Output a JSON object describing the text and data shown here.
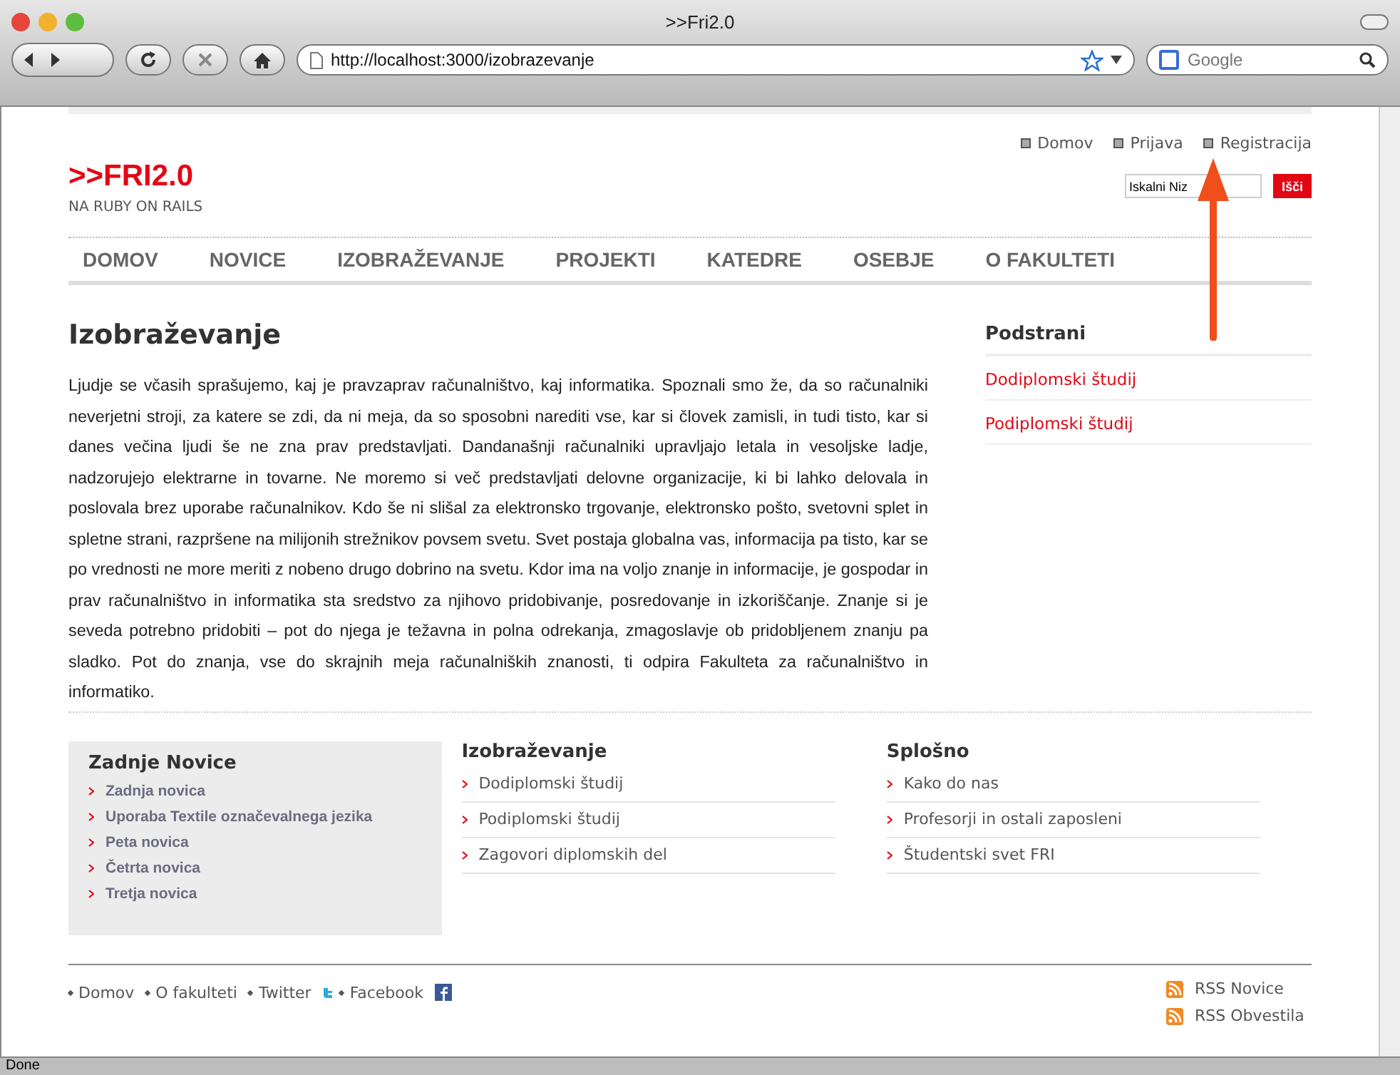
{
  "window": {
    "title": ">>Fri2.0"
  },
  "toolbar": {
    "url": "http://localhost:3000/izobrazevanje",
    "search_placeholder": "Google"
  },
  "site": {
    "logo": ">>FRI2.0",
    "tagline": "NA RUBY ON RAILS"
  },
  "top_links": [
    "Domov",
    "Prijava",
    "Registracija"
  ],
  "search": {
    "value": "Iskalni Niz",
    "button": "Išči"
  },
  "nav": [
    {
      "label": "DOMOV"
    },
    {
      "label": "NOVICE"
    },
    {
      "label": "IZOBRAŽEVANJE"
    },
    {
      "label": "PROJEKTI"
    },
    {
      "label": "KATEDRE"
    },
    {
      "label": "OSEBJE"
    },
    {
      "label": "O FAKULTETI"
    }
  ],
  "article": {
    "title": "Izobraževanje",
    "body": "Ljudje se včasih sprašujemo, kaj je pravzaprav računalništvo, kaj informatika. Spoznali smo že, da so računalniki neverjetni stroji, za katere se zdi, da ni meja, da so sposobni narediti vse, kar si človek zamisli, in tudi tisto, kar si danes večina ljudi še ne zna prav predstavljati. Dandanašnji računalniki upravljajo letala in vesoljske ladje, nadzorujejo elektrarne in tovarne. Ne moremo si več predstavljati delovne organizacije, ki bi lahko delovala in poslovala brez uporabe računalnikov. Kdo še ni slišal za elektronsko trgovanje, elektronsko pošto, svetovni splet in spletne strani, razpršene na milijonih strežnikov povsem svetu. Svet postaja globalna vas, informacija pa tisto, kar se po vrednosti ne more meriti z nobeno drugo dobrino na svetu. Kdor ima na voljo znanje in informacije, je gospodar in prav računalništvo in informatika sta sredstvo za njihovo pridobivanje, posredovanje in izkoriščanje. Znanje si je seveda potrebno pridobiti – pot do njega je težavna in polna odrekanja, zmagoslavje ob pridobljenem znanju pa sladko. Pot do znanja, vse do skrajnih meja računalniških znanosti, ti odpira Fakulteta za računalništvo in informatiko."
  },
  "sidebar": {
    "title": "Podstrani",
    "items": [
      "Dodiplomski študij",
      "Podiplomski študij"
    ]
  },
  "footer_boxes": [
    {
      "title": "Zadnje Novice",
      "kind": "news",
      "items": [
        "Zadnja novica",
        "Uporaba Textile označevalnega jezika",
        "Peta novica",
        "Četrta novica",
        "Tretja novica"
      ]
    },
    {
      "title": "Izobraževanje",
      "kind": "links",
      "items": [
        "Dodiplomski študij",
        "Podiplomski študij",
        "Zagovori diplomskih del"
      ]
    },
    {
      "title": "Splošno",
      "kind": "links",
      "items": [
        "Kako do nas",
        "Profesorji in ostali zaposleni",
        "Študentski svet FRI"
      ]
    }
  ],
  "footer_links": [
    "Domov",
    "O fakulteti",
    "Twitter",
    "Facebook"
  ],
  "rss_links": [
    "RSS Novice",
    "RSS Obvestila"
  ],
  "status_bar": "Done"
}
